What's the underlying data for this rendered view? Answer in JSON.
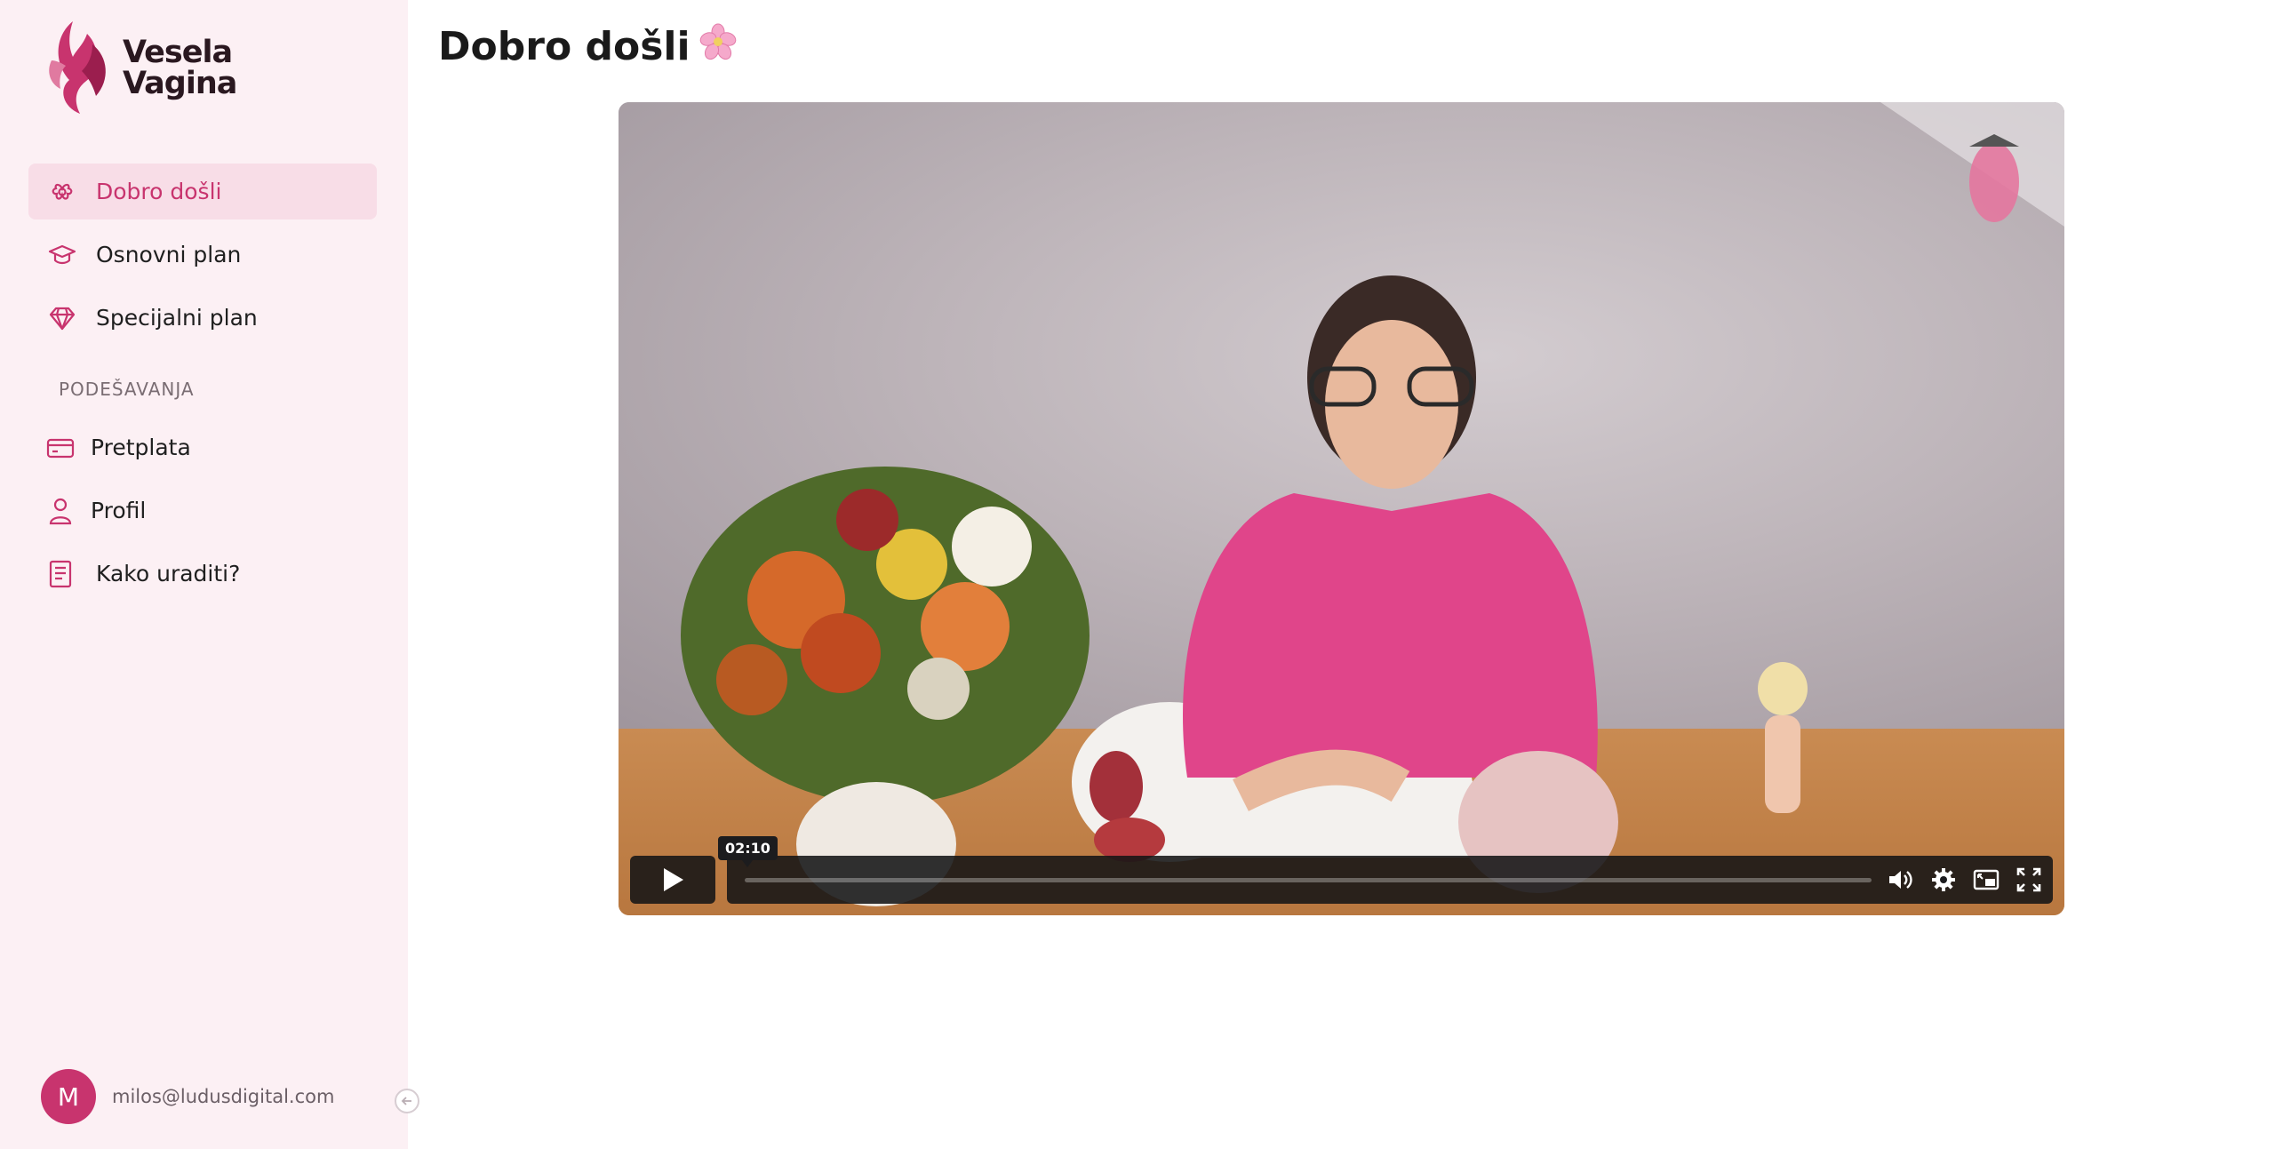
{
  "app": {
    "logo_line1": "Vesela",
    "logo_line2": "Vagina",
    "brand_color": "#c8346e"
  },
  "sidebar": {
    "main_nav": [
      {
        "label": "Dobro došli",
        "icon": "flower-outline-icon",
        "active": true
      },
      {
        "label": "Osnovni plan",
        "icon": "graduation-cap-icon",
        "active": false
      },
      {
        "label": "Specijalni plan",
        "icon": "diamond-icon",
        "active": false
      }
    ],
    "section_label": "PODEŠAVANJA",
    "settings_nav": [
      {
        "label": "Pretplata",
        "icon": "credit-card-icon"
      },
      {
        "label": "Profil",
        "icon": "user-icon"
      },
      {
        "label": "Kako uraditi?",
        "icon": "document-icon"
      }
    ],
    "user": {
      "initial": "M",
      "email": "milos@ludusdigital.com"
    }
  },
  "main": {
    "title": "Dobro došli",
    "title_emoji": "🌸",
    "video": {
      "hover_time": "02:10",
      "controls": [
        "play-icon",
        "volume-icon",
        "settings-icon",
        "picture-in-picture-icon",
        "fullscreen-icon"
      ]
    }
  }
}
